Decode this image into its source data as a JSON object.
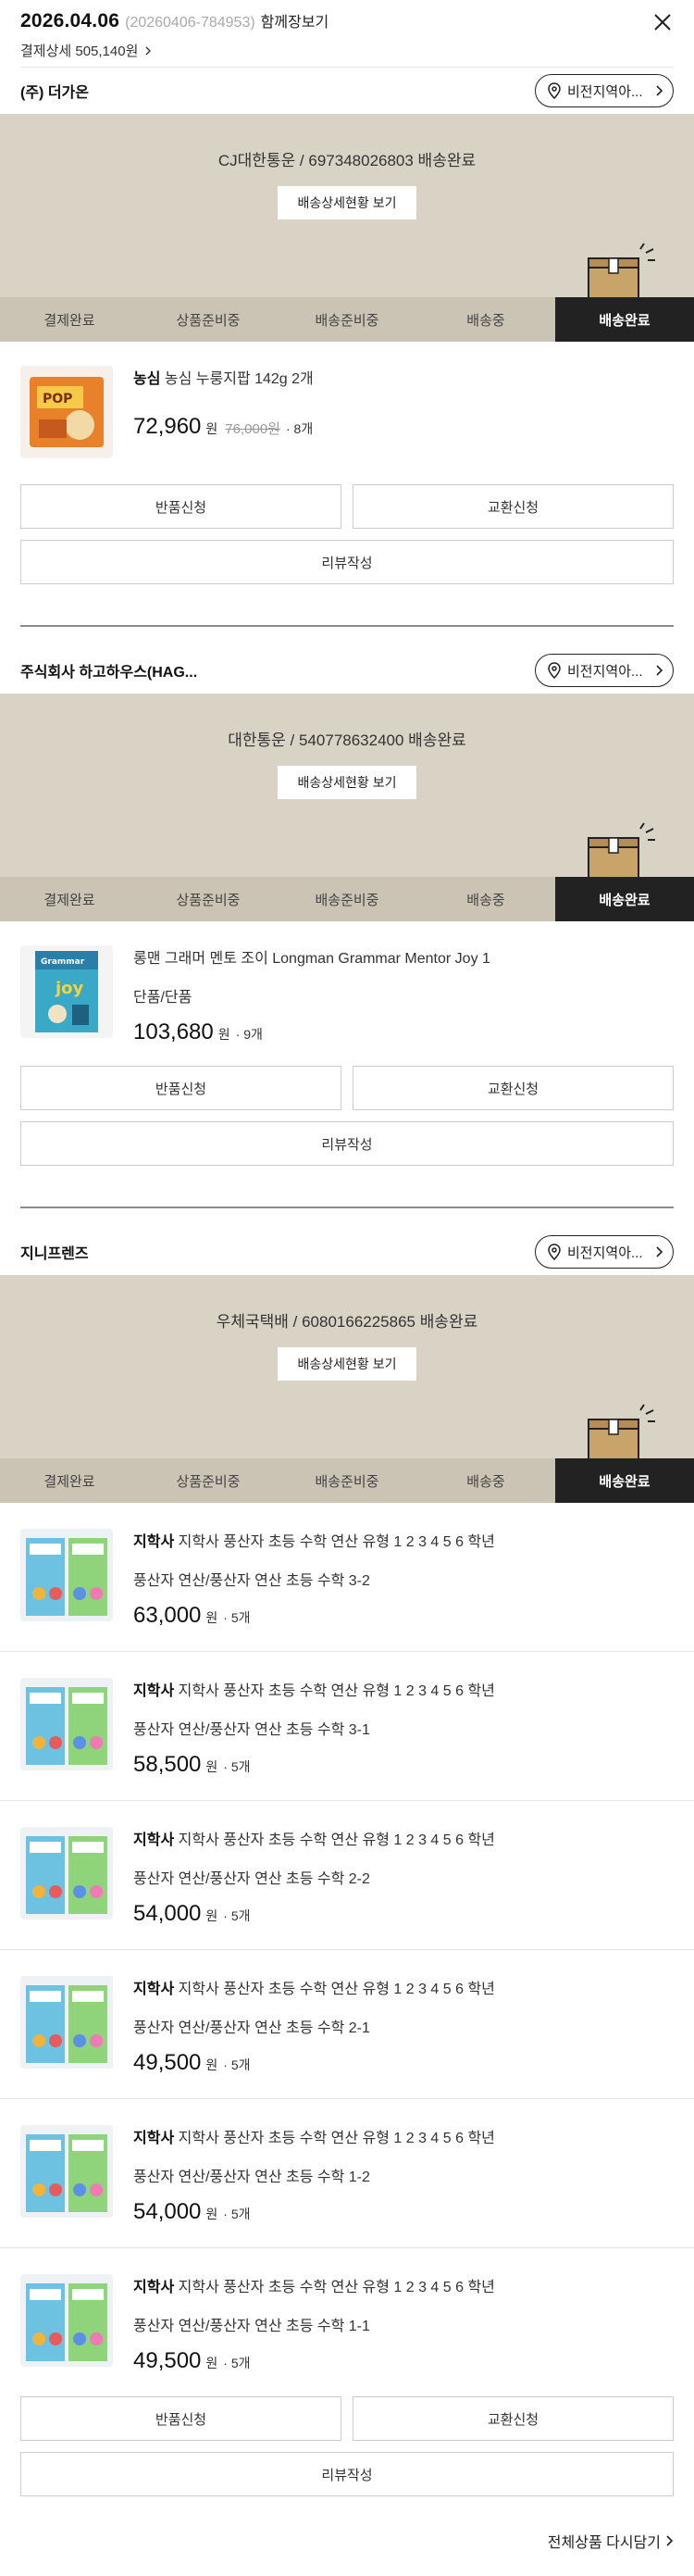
{
  "header": {
    "date": "2026.04.06",
    "order_no": "(20260406-784953)",
    "together_label": "함께장보기",
    "payment_detail": "결제상세 505,140원"
  },
  "common": {
    "track_button": "배송상세현황 보기",
    "steps": [
      "결제완료",
      "상품준비중",
      "배송준비중",
      "배송중",
      "배송완료"
    ],
    "return_label": "반품신청",
    "exchange_label": "교환신청",
    "review_label": "리뷰작성",
    "region_pill": "비전지역아..."
  },
  "sellers": [
    {
      "name": "(주) 더가온",
      "tracking": "CJ대한통운 / 697348026803 배송완료",
      "items": [
        {
          "brand": "농심",
          "title": "농심 누룽지팝 142g 2개",
          "option": "",
          "price": "72,960",
          "won": "원",
          "orig": "76,000원",
          "qty": "· 8개"
        }
      ]
    },
    {
      "name": "주식회사 하고하우스(HAG...",
      "tracking": "대한통운 / 540778632400 배송완료",
      "items": [
        {
          "brand": "",
          "title": "롱맨 그래머 멘토 조이 Longman Grammar Mentor Joy 1",
          "option": "단품/단품",
          "price": "103,680",
          "won": "원",
          "orig": "",
          "qty": "· 9개"
        }
      ]
    },
    {
      "name": "지니프렌즈",
      "tracking": "우체국택배 / 6080166225865 배송완료",
      "items": [
        {
          "brand": "지학사",
          "title": "지학사 풍산자 초등 수학 연산 유형 1 2 3 4 5 6 학년",
          "option": "풍산자 연산/풍산자 연산 초등 수학 3-2",
          "price": "63,000",
          "won": "원",
          "orig": "",
          "qty": "· 5개"
        },
        {
          "brand": "지학사",
          "title": "지학사 풍산자 초등 수학 연산 유형 1 2 3 4 5 6 학년",
          "option": "풍산자 연산/풍산자 연산 초등 수학 3-1",
          "price": "58,500",
          "won": "원",
          "orig": "",
          "qty": "· 5개"
        },
        {
          "brand": "지학사",
          "title": "지학사 풍산자 초등 수학 연산 유형 1 2 3 4 5 6 학년",
          "option": "풍산자 연산/풍산자 연산 초등 수학 2-2",
          "price": "54,000",
          "won": "원",
          "orig": "",
          "qty": "· 5개"
        },
        {
          "brand": "지학사",
          "title": "지학사 풍산자 초등 수학 연산 유형 1 2 3 4 5 6 학년",
          "option": "풍산자 연산/풍산자 연산 초등 수학 2-1",
          "price": "49,500",
          "won": "원",
          "orig": "",
          "qty": "· 5개"
        },
        {
          "brand": "지학사",
          "title": "지학사 풍산자 초등 수학 연산 유형 1 2 3 4 5 6 학년",
          "option": "풍산자 연산/풍산자 연산 초등 수학 1-2",
          "price": "54,000",
          "won": "원",
          "orig": "",
          "qty": "· 5개"
        },
        {
          "brand": "지학사",
          "title": "지학사 풍산자 초등 수학 연산 유형 1 2 3 4 5 6 학년",
          "option": "풍산자 연산/풍산자 연산 초등 수학 1-1",
          "price": "49,500",
          "won": "원",
          "orig": "",
          "qty": "· 5개"
        }
      ]
    }
  ],
  "footer": {
    "reorder_all": "전체상품 다시담기"
  }
}
